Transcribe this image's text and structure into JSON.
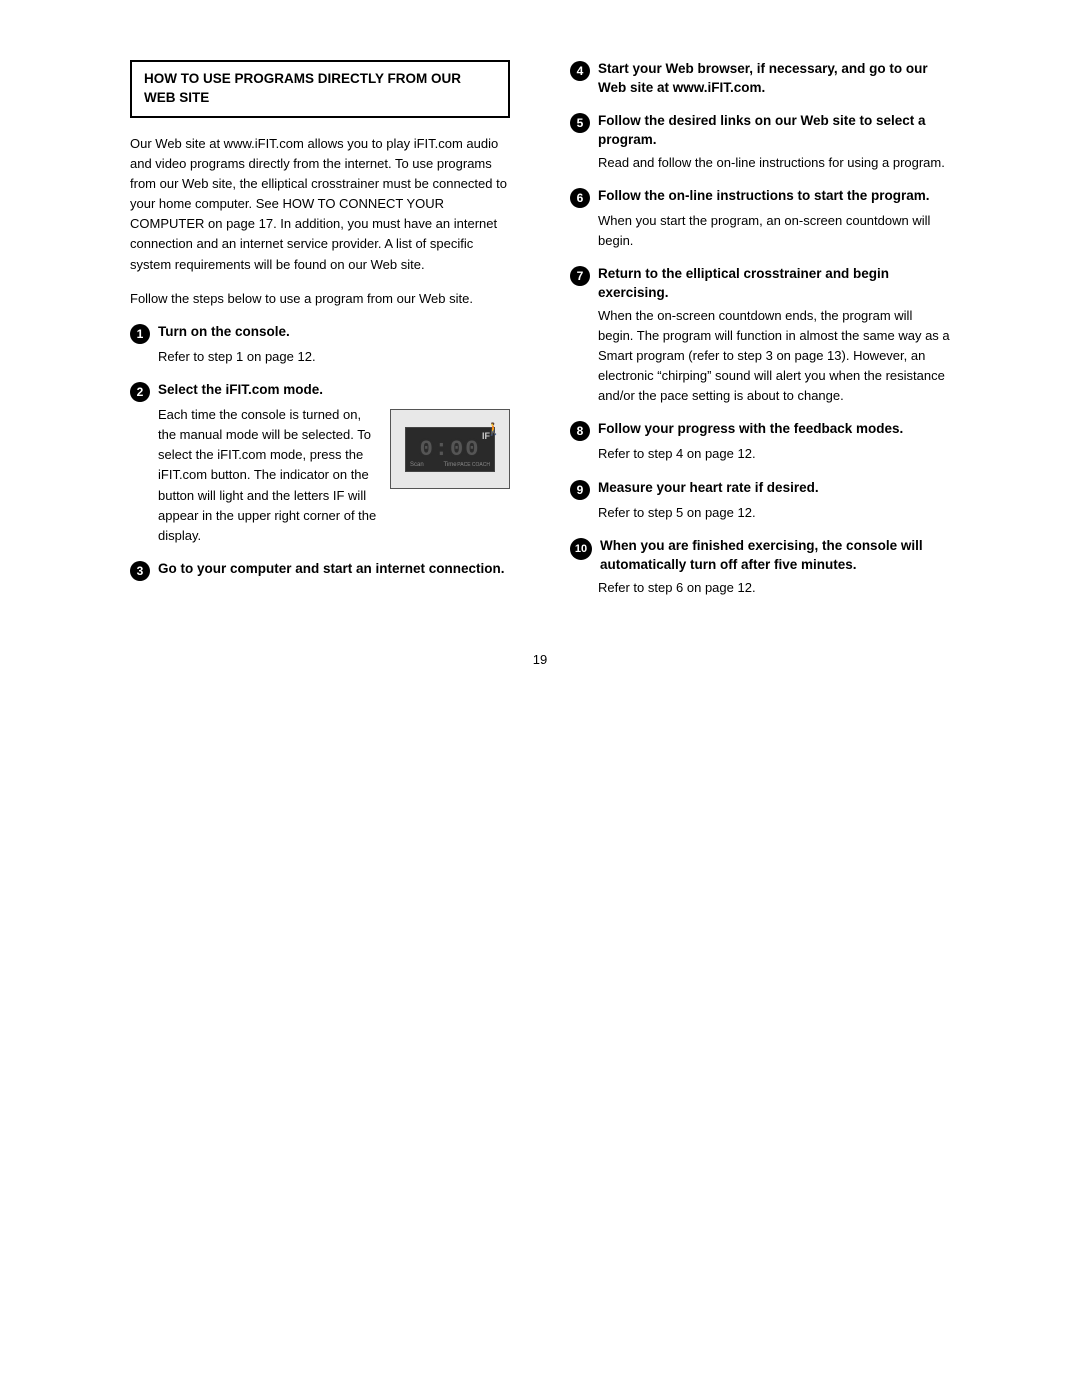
{
  "page": {
    "number": "19",
    "left_column": {
      "section_header": "HOW TO USE PROGRAMS DIRECTLY FROM OUR WEB SITE",
      "intro_paragraph1": "Our Web site at www.iFIT.com allows you to play iFIT.com audio and video programs directly from the internet. To use programs from our Web site, the elliptical crosstrainer must be connected to your home computer. See HOW TO CONNECT YOUR COMPUTER on page 17. In addition, you must have an internet connection and an internet service provider. A list of specific system requirements will be found on our Web site.",
      "intro_paragraph2": "Follow the steps below to use a program from our Web site.",
      "steps": [
        {
          "number": "1",
          "title": "Turn on the console.",
          "body": "Refer to step 1 on page 12."
        },
        {
          "number": "2",
          "title": "Select the iFIT.com mode.",
          "body_part1": "Each time the console is turned on, the manual mode will be selected. To select the iFIT.com mode, press the iFIT.com button. The indicator on the button will light and the letters IF will appear in the upper right corner of the display.",
          "has_image": true
        },
        {
          "number": "3",
          "title": "Go to your computer and start an internet connection."
        }
      ]
    },
    "right_column": {
      "steps": [
        {
          "number": "4",
          "title": "Start your Web browser, if necessary, and go to our Web site at www.iFIT.com."
        },
        {
          "number": "5",
          "title": "Follow the desired links on our Web site to select a program.",
          "body": "Read and follow the on-line instructions for using a program."
        },
        {
          "number": "6",
          "title": "Follow the on-line instructions to start the program.",
          "body": "When you start the program, an on-screen countdown will begin."
        },
        {
          "number": "7",
          "title": "Return to the elliptical crosstrainer and begin exercising.",
          "body": "When the on-screen countdown ends, the program will begin. The program will function in almost the same way as a Smart program (refer to step 3 on page 13). However, an electronic “chirping” sound will alert you when the resistance and/or the pace setting is about to change."
        },
        {
          "number": "8",
          "title": "Follow your progress with the feedback modes.",
          "body": "Refer to step 4 on page 12."
        },
        {
          "number": "9",
          "title": "Measure your heart rate if desired.",
          "body": "Refer to step 5 on page 12."
        },
        {
          "number": "10",
          "title": "When you are finished exercising, the console will automatically turn off after five minutes.",
          "body": "Refer to step 6 on page 12."
        }
      ]
    }
  }
}
